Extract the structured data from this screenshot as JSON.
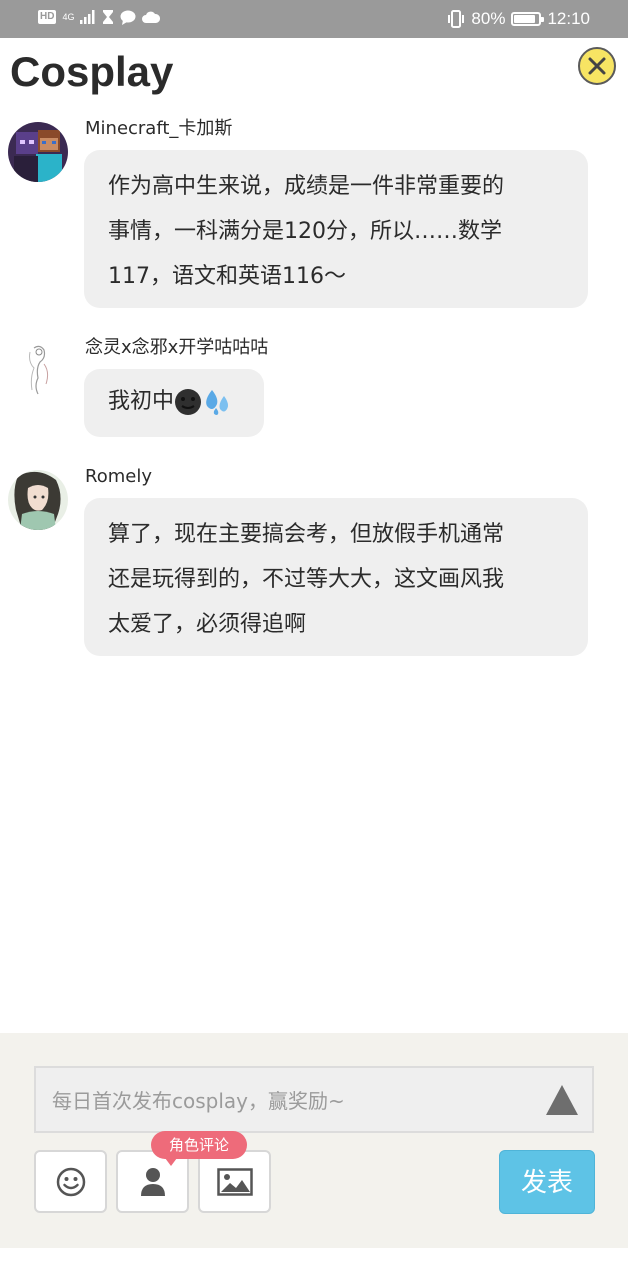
{
  "status_bar": {
    "hd": "HD",
    "network": "4G",
    "battery_percent_text": "80%",
    "battery_level": 0.8,
    "time": "12:10"
  },
  "header": {
    "title": "Cosplay",
    "close_icon": "close-circle-icon"
  },
  "comments": [
    {
      "username": "Minecraft_卡加斯",
      "lines": [
        "作为高中生来说，成绩是一件非常重要的",
        "事情，一科满分是120分，所以……数学",
        "117，语文和英语116～"
      ]
    },
    {
      "username": "念灵x念邪x开学咕咕咕",
      "text": "我初中",
      "emojis": [
        "dark-moon-face-emoji",
        "sweat-droplets-emoji"
      ]
    },
    {
      "username": "Romely",
      "lines": [
        "算了，现在主要搞会考，但放假手机通常",
        "还是玩得到的，不过等大大，这文画风我",
        "太爱了，必须得追啊"
      ]
    }
  ],
  "composer": {
    "placeholder": "每日首次发布cosplay，赢奖励~",
    "send_icon": "triangle-send-icon",
    "role_tag": "角色评论",
    "buttons": [
      "smiley-icon",
      "person-icon",
      "image-icon"
    ],
    "post_label": "发表"
  },
  "colors": {
    "status_bar": "#9a9a9a",
    "close_button": "#f7e463",
    "bubble": "#efefef",
    "post_button": "#5ec3e6",
    "role_tag": "#ee6b7a",
    "panel": "#f3f2ed"
  }
}
